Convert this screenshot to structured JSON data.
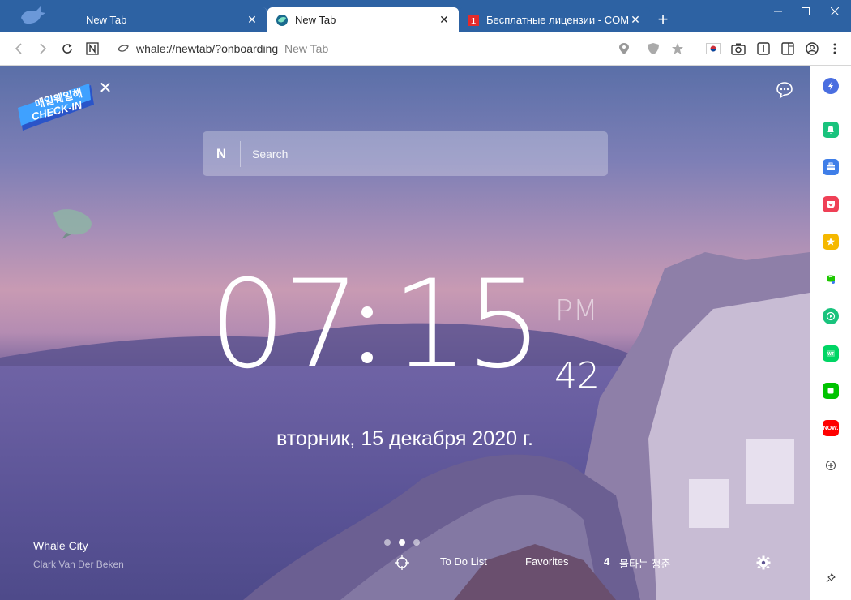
{
  "tabs": [
    {
      "label": "New Tab",
      "active": false
    },
    {
      "label": "New Tab",
      "active": true
    },
    {
      "label": "Бесплатные лицензии - COMSS",
      "active": false
    }
  ],
  "new_tab_symbol": "+",
  "toolbar": {
    "url": "whale://newtab/?onboarding",
    "page_title": "New Tab"
  },
  "newtab": {
    "checkin_line1": "매일웨일해",
    "checkin_line2": "CHECK-IN",
    "search_placeholder": "Search",
    "search_logo": "N",
    "clock": {
      "hours": "07",
      "minutes": "15",
      "ampm": "PM",
      "seconds": "42"
    },
    "date": "вторник, 15 декабря 2020 г.",
    "wallpaper": {
      "title": "Whale City",
      "author": "Clark Van Der Beken"
    },
    "bottom": {
      "todo": "To Do List",
      "favorites": "Favorites",
      "rank": "4",
      "trending": "불타는 청춘"
    },
    "dots_total": 3,
    "dots_active": 1
  },
  "colors": {
    "titlebar": "#2d62a3",
    "accent": "#2d62a3"
  },
  "sidebar": {
    "items": [
      {
        "icon": "lightning-search-icon",
        "color": "#4a6ee0"
      },
      {
        "icon": "bell-icon",
        "color": "#19c37d"
      },
      {
        "icon": "toolbox-icon",
        "color": "#3f7ee8"
      },
      {
        "icon": "pocket-icon",
        "color": "#ef4056"
      },
      {
        "icon": "star-icon",
        "color": "#f5b800"
      },
      {
        "icon": "papago-icon",
        "color": "#1ec800"
      },
      {
        "icon": "play-icon",
        "color": "#19c37d"
      },
      {
        "icon": "webtoon-icon",
        "color": "#00d564"
      },
      {
        "icon": "line-icon",
        "color": "#00c300"
      },
      {
        "icon": "now-icon",
        "color": "#ff0000"
      }
    ],
    "now_label": "NOW."
  }
}
